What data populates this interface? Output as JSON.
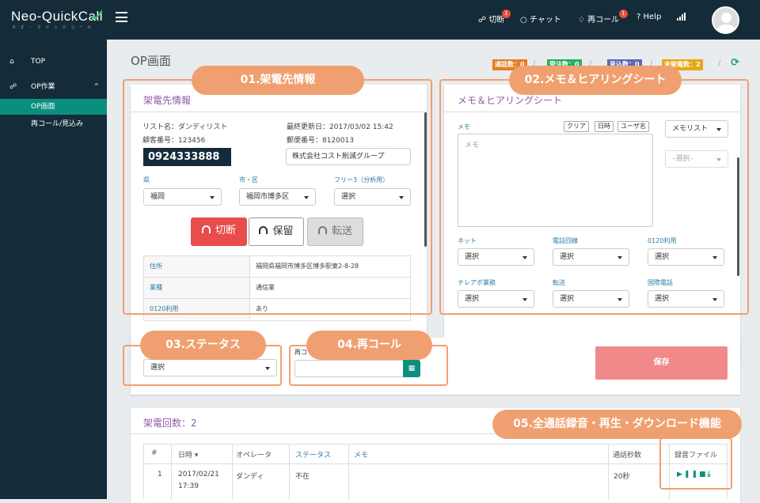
{
  "header": {
    "logo": "Neo-QuickCall",
    "logo_sub": "ネ オ ・ ク イ ッ ク コ ー ル  ",
    "nav": {
      "hangup": "切断",
      "hangup_badge": "1",
      "chat": "チャット",
      "recall": "再コール",
      "recall_badge": "1",
      "help": "Help"
    }
  },
  "sidebar": {
    "top": "TOP",
    "op_work": "OP作業",
    "op_screen": "OP画面",
    "recall_prospect": "再コール/見込み"
  },
  "page": {
    "title": "OP画面",
    "stats": [
      {
        "label": "通話数：0",
        "color": "#e67e22"
      },
      {
        "label": "受注数：0",
        "color": "#27ae60"
      },
      {
        "label": "見込数：0",
        "color": "#5b6bb5"
      },
      {
        "label": "未架電数：2",
        "color": "#e6a817"
      }
    ]
  },
  "call_info": {
    "title": "架電先情報",
    "list_name": "リスト名：ダンディリスト",
    "last_updated": "最終更新日：2017/03/02 15:42",
    "customer_no": "顧客番号：123456",
    "postal": "郵便番号：8120013",
    "phone": "0924333888",
    "company": "株式会社コスト削減グループ",
    "pref_label": "県",
    "pref_value": "福岡",
    "city_label": "市・区",
    "city_value": "福岡市博多区",
    "free3_label": "フリー3（分析用）",
    "free3_value": "選択",
    "btn_hangup": "切断",
    "btn_hold": "保留",
    "btn_transfer": "転送",
    "table": [
      {
        "k": "住所",
        "v": "福岡県福岡市博多区博多駅東2-8-28"
      },
      {
        "k": "業種",
        "v": "通信業"
      },
      {
        "k": "0120利用",
        "v": "あり"
      }
    ]
  },
  "memo": {
    "title": "メモ＆ヒアリングシート",
    "memo_label": "メモ",
    "btn_clear": "クリア",
    "btn_datetime": "日時",
    "btn_user": "ユーザ名",
    "memo_list": "メモリスト",
    "memo_placeholder": "メモ",
    "disabled_select": "–選択–",
    "fields": [
      {
        "label": "ネット",
        "value": "選択"
      },
      {
        "label": "電話回線",
        "value": "選択"
      },
      {
        "label": "0120利用",
        "value": "選択"
      },
      {
        "label": "テレアポ業務",
        "value": "選択"
      },
      {
        "label": "転送",
        "value": "選択"
      },
      {
        "label": "国際電話",
        "value": "選択"
      }
    ]
  },
  "status": {
    "value": "選択",
    "recall_label": "再コ"
  },
  "save": {
    "label": "保存"
  },
  "history": {
    "title": "架電回数：2",
    "cols": {
      "no": "#",
      "date": "日時",
      "operator": "オペレータ",
      "status": "ステータス",
      "memo": "メモ",
      "seconds": "通話秒数",
      "file": "録音ファイル"
    },
    "rows": [
      {
        "no": "1",
        "date": "2017/02/21",
        "time": "17:39",
        "operator": "ダンディ",
        "status": "不在",
        "seconds": "20秒"
      }
    ]
  },
  "callouts": [
    "01.架電先情報",
    "02.メモ＆ヒアリングシート",
    "03.ステータス",
    "04.再コール",
    "05.全通話録音・再生・ダウンロード機能"
  ]
}
